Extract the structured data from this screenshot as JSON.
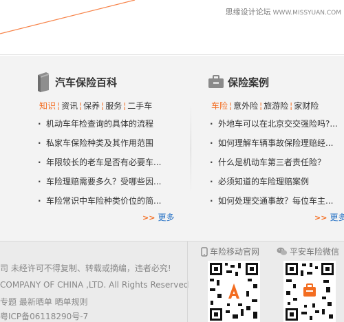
{
  "watermark": {
    "text": "思缘设计论坛",
    "url": "WWW.MISSYUAN.COM"
  },
  "left": {
    "title": "汽车保险百科",
    "tabs": [
      {
        "label": "知识",
        "active": true
      },
      {
        "label": "资讯",
        "active": false
      },
      {
        "label": "保养",
        "active": false
      },
      {
        "label": "服务",
        "active": false
      },
      {
        "label": "二手车",
        "active": false
      }
    ],
    "items": [
      "机动车年检查询的具体的流程",
      "私家车保险种类及其作用范围",
      "年限较长的老车是否有必要车...",
      "车险理赔需要多久？受哪些因...",
      "车险常识中车险种类价位的简..."
    ],
    "more": "更多"
  },
  "right": {
    "title": "保险案例",
    "tabs": [
      {
        "label": "车险",
        "active": true
      },
      {
        "label": "意外险",
        "active": false
      },
      {
        "label": "旅游险",
        "active": false
      },
      {
        "label": "家财险",
        "active": false
      }
    ],
    "items": [
      "外地车可以在北京交交强险吗?...",
      "如何理解车辆事故保险理赔经...",
      "什么是机动车第三者责任险？",
      "必须知道的车险理赔案例",
      "如何处理交通事故？每位车主..."
    ],
    "more": "更多"
  },
  "footer": {
    "line1": "司 未经许可不得复制、转载或摘编，违者必究!",
    "line2": "COMPANY OF CHINA ,LTD. All Rights Reserved",
    "line3": "专题 最新晒单 晒单规则",
    "line4": "粤ICP备06118290号-7",
    "qr_mobile_label": "车险移动官网",
    "qr_wechat_label": "平安车险微信"
  },
  "colors": {
    "accent": "#f36d21",
    "link": "#2a74c6"
  }
}
